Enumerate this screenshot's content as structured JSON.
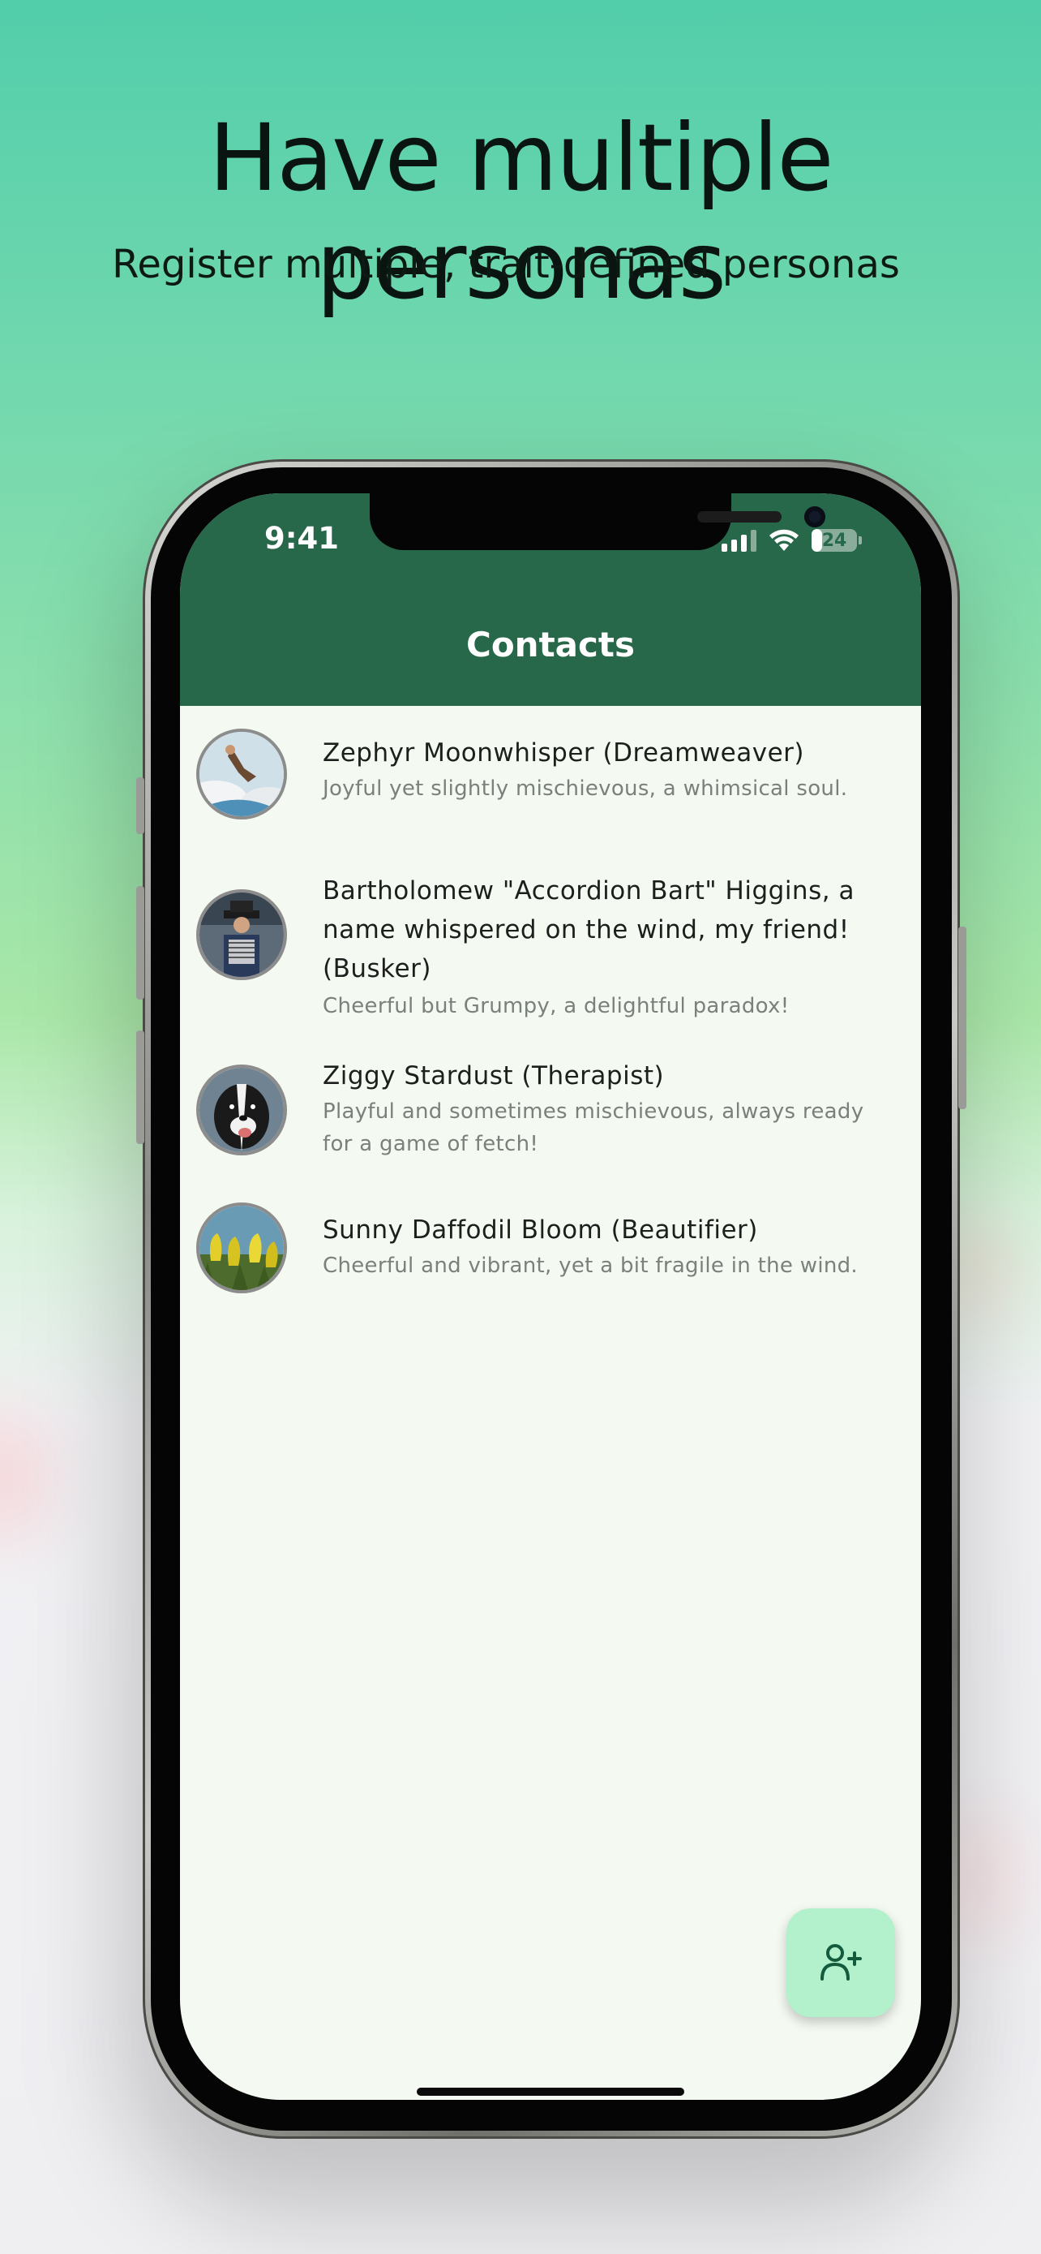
{
  "headline": "Have multiple personas",
  "subheadline": "Register multiple, trait-defined personas",
  "status_bar": {
    "time": "9:41",
    "battery_level": "24",
    "icons": [
      "cellular-signal-icon",
      "wifi-icon",
      "battery-icon"
    ]
  },
  "app": {
    "title": "Contacts",
    "colors": {
      "header": "#28684a",
      "background": "#f4faf2",
      "fab": "#b3f1cc"
    }
  },
  "contacts": [
    {
      "name": "Zephyr Moonwhisper (Dreamweaver)",
      "trait": "Joyful yet slightly mischievous, a whimsical soul.",
      "avatar": "person-jumping-over-clouds"
    },
    {
      "name_lines": [
        "Bartholomew \"Accordion Bart\" Higgins, a",
        "name whispered on the wind, my friend!",
        "(Busker)"
      ],
      "trait": "Cheerful but Grumpy, a delightful paradox!",
      "avatar": "accordion-player"
    },
    {
      "name": "Ziggy Stardust (Therapist)",
      "trait_lines": [
        "Playful and sometimes mischievous, always ready",
        "for a game of fetch!"
      ],
      "avatar": "border-collie-dog"
    },
    {
      "name": "Sunny Daffodil Bloom (Beautifier)",
      "trait": "Cheerful and vibrant, yet a bit fragile in the wind.",
      "avatar": "yellow-tulips"
    }
  ],
  "fab": {
    "icon": "add-person-icon"
  }
}
